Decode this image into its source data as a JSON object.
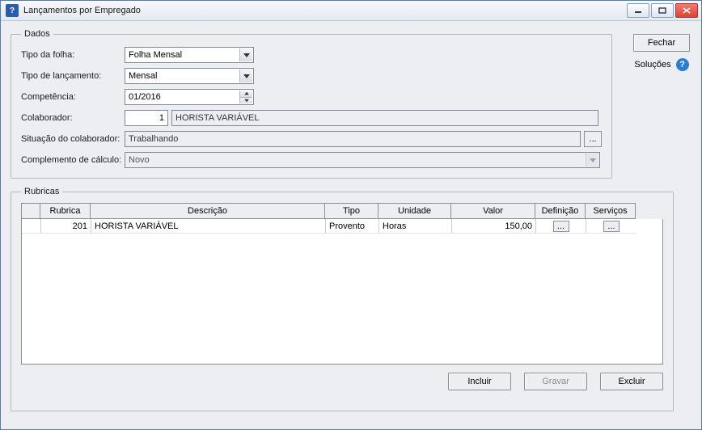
{
  "window": {
    "title": "Lançamentos por Empregado",
    "icon_label": "?"
  },
  "side": {
    "close_label": "Fechar",
    "solucoes_label": "Soluções"
  },
  "dados": {
    "legend": "Dados",
    "tipo_folha": {
      "label": "Tipo da folha:",
      "value": "Folha Mensal"
    },
    "tipo_lanc": {
      "label": "Tipo de lançamento:",
      "value": "Mensal"
    },
    "competencia": {
      "label": "Competência:",
      "value": "01/2016"
    },
    "colaborador": {
      "label": "Colaborador:",
      "codigo": "1",
      "nome": "HORISTA VARIÁVEL"
    },
    "situacao": {
      "label": "Situação do colaborador:",
      "value": "Trabalhando"
    },
    "complemento": {
      "label": "Complemento de cálculo:",
      "value": "Novo"
    }
  },
  "rubricas": {
    "legend": "Rubricas",
    "headers": {
      "rubrica": "Rubrica",
      "descricao": "Descrição",
      "tipo": "Tipo",
      "unidade": "Unidade",
      "valor": "Valor",
      "definicao": "Definição",
      "servicos": "Serviços"
    },
    "rows": [
      {
        "rubrica": "201",
        "descricao": "HORISTA VARIÁVEL",
        "tipo": "Provento",
        "unidade": "Horas",
        "valor": "150,00"
      }
    ],
    "buttons": {
      "incluir": "Incluir",
      "gravar": "Gravar",
      "excluir": "Excluir"
    }
  },
  "dots": "..."
}
